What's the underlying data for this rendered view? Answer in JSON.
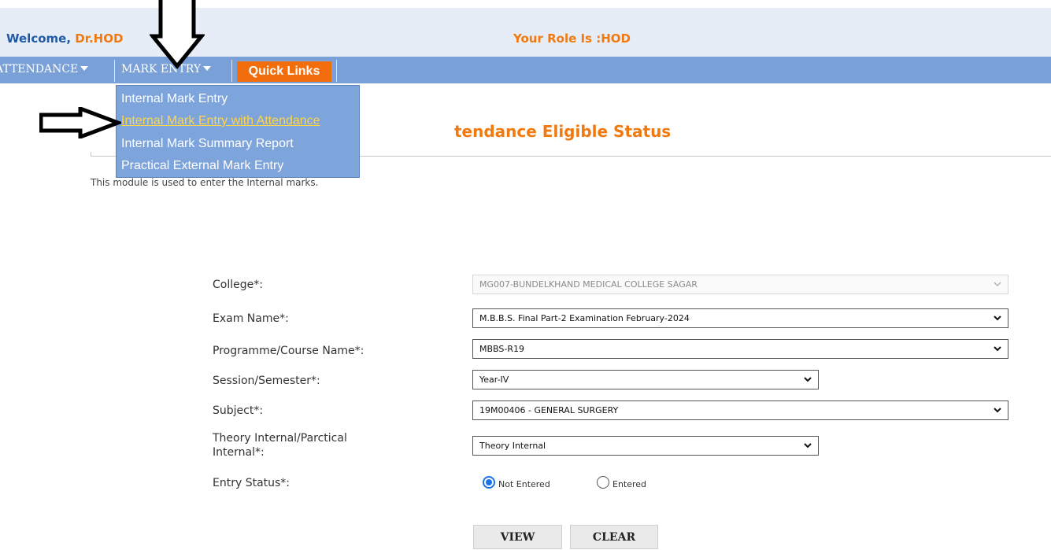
{
  "header": {
    "welcome_label": "Welcome,",
    "user_name": "Dr.HOD",
    "role_text": "Your Role Is :HOD"
  },
  "nav": {
    "attendance": "ATTENDANCE",
    "mark_entry": "MARK ENTRY",
    "quick_links": "Quick Links"
  },
  "dropdown": {
    "items": [
      "Internal Mark Entry",
      "Internal Mark Entry with Attendance",
      "Internal Mark Summary Report",
      "Practical External Mark Entry"
    ],
    "active_index": 1
  },
  "page": {
    "title_visible": "tendance Eligible Status",
    "description": "This module is used to enter the Internal marks."
  },
  "form": {
    "college_label": "College*:",
    "college_value": "MG007-BUNDELKHAND MEDICAL COLLEGE SAGAR",
    "exam_label": "Exam Name*:",
    "exam_value": "M.B.B.S. Final Part-2 Examination February-2024",
    "programme_label": "Programme/Course Name*:",
    "programme_value": "MBBS-R19",
    "session_label": "Session/Semester*:",
    "session_value": "Year-IV",
    "subject_label": "Subject*:",
    "subject_value": "19M00406 - GENERAL SURGERY",
    "type_label_line1": "Theory Internal/Parctical",
    "type_label_line2": "Internal*:",
    "type_value": "Theory Internal",
    "entry_status_label": "Entry Status*:",
    "entry_status_options": [
      "Not Entered",
      "Entered"
    ],
    "entry_status_selected": "Not Entered"
  },
  "buttons": {
    "view": "VIEW",
    "clear": "CLEAR"
  },
  "colors": {
    "nav_bar": "#7aa0d8",
    "accent_orange": "#f07a10",
    "quick_links_bg": "#f26e0c",
    "welcome_blue": "#1f5aa6"
  }
}
